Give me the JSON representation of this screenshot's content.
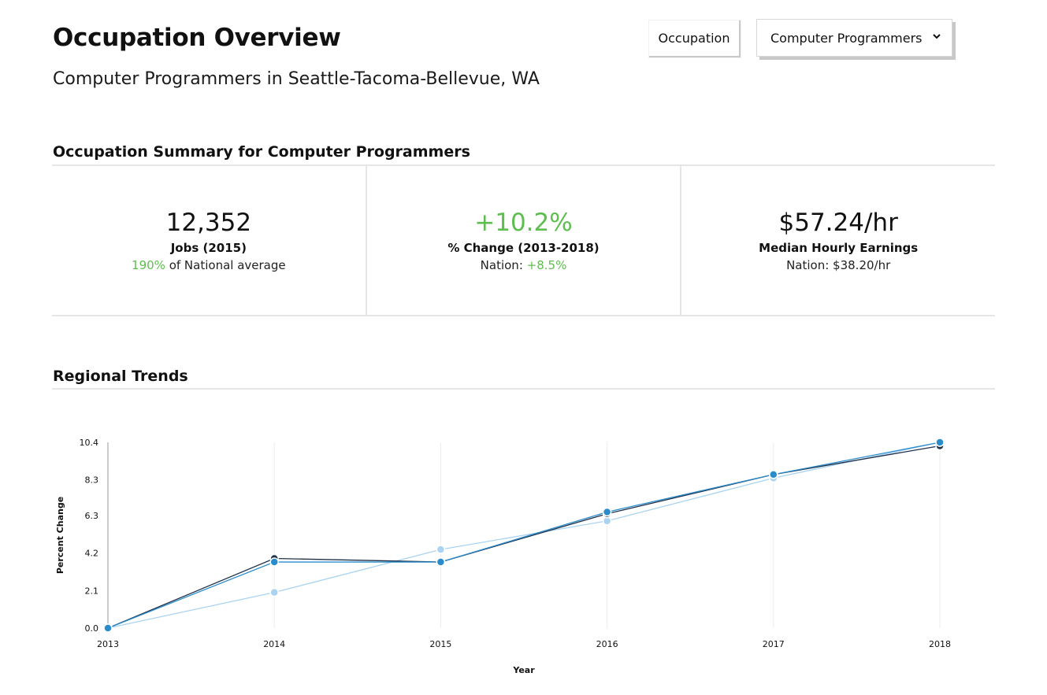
{
  "header": {
    "title": "Occupation Overview",
    "subtitle": "Computer Programmers in Seattle-Tacoma-Bellevue, WA",
    "occupation_button_label": "Occupation",
    "occupation_select_value": "Computer Programmers"
  },
  "summary": {
    "title": "Occupation Summary for Computer Programmers",
    "cards": [
      {
        "value": "12,352",
        "label": "Jobs (2015)",
        "note_highlight": "190%",
        "note_text": " of National average"
      },
      {
        "value": "+10.2%",
        "label": "% Change (2013-2018)",
        "note_text": "Nation: ",
        "note_highlight": "+8.5%"
      },
      {
        "value": "$57.24/hr",
        "label": "Median Hourly Earnings",
        "note_text": "Nation: $38.20/hr"
      }
    ]
  },
  "trends": {
    "title": "Regional Trends"
  },
  "colors": {
    "positive": "#5ebd4f",
    "series_dark": "#1f3049",
    "series_mid": "#2b8ccb",
    "series_light": "#a9d3f1"
  },
  "chart_data": {
    "type": "line",
    "x": [
      2013,
      2014,
      2015,
      2016,
      2017,
      2018
    ],
    "xlabel": "Year",
    "ylabel": "Percent Change",
    "yticks": [
      "0.0",
      "2.1",
      "4.2",
      "6.3",
      "8.3",
      "10.4"
    ],
    "ylim": [
      0,
      10.4
    ],
    "grid": "vertical",
    "legend": "none",
    "series": [
      {
        "color": "#1f3049",
        "values": [
          0.0,
          3.9,
          3.7,
          6.4,
          8.6,
          10.2
        ]
      },
      {
        "color": "#2b8ccb",
        "values": [
          0.0,
          3.7,
          3.7,
          6.5,
          8.6,
          10.4
        ]
      },
      {
        "color": "#a9d3f1",
        "values": [
          0.0,
          2.0,
          4.4,
          6.0,
          8.4,
          10.4
        ]
      }
    ]
  }
}
